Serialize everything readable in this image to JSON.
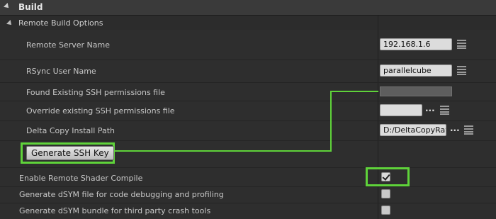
{
  "section": {
    "title": "Build"
  },
  "subsection": {
    "title": "Remote Build Options"
  },
  "rows": {
    "remote_server_name": {
      "label": "Remote Server Name",
      "value": "192.168.1.6"
    },
    "rsync_user_name": {
      "label": "RSync User Name",
      "value": "parallelcube"
    },
    "found_ssh_file": {
      "label": "Found Existing SSH permissions file",
      "value": ""
    },
    "override_ssh_file": {
      "label": "Override existing SSH permissions file",
      "value": ""
    },
    "delta_copy_path": {
      "label": "Delta Copy Install Path",
      "value": "D:/DeltaCopyRaw"
    },
    "generate_ssh_key": {
      "button_label": "Generate SSH Key"
    },
    "enable_remote_shader": {
      "label": "Enable Remote Shader Compile",
      "checked": true
    },
    "gen_dsym_file": {
      "label": "Generate dSYM file for code debugging and profiling",
      "checked": false
    },
    "gen_dsym_bundle": {
      "label": "Generate dSYM bundle for third party crash tools",
      "checked": false
    }
  },
  "browse_button_label": "...",
  "colors": {
    "highlight": "#5fd33a",
    "panel": "#2e2e2e",
    "header": "#3a3a3a"
  },
  "icons": [
    "expand-arrow-icon",
    "array-grid-icon",
    "checkmark-icon"
  ]
}
